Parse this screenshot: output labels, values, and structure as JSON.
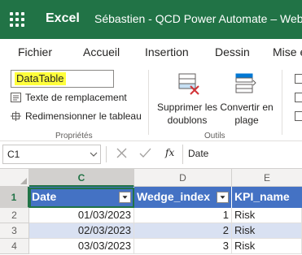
{
  "titlebar": {
    "app_name": "Excel",
    "document_title": "Sébastien - QCD Power Automate – Webi"
  },
  "ribbon_tabs": [
    "Fichier",
    "Accueil",
    "Insertion",
    "Dessin",
    "Mise e"
  ],
  "ribbon": {
    "table_name": "DataTable",
    "replacement_text": "Texte de remplacement",
    "resize_table": "Redimensionner le tableau",
    "properties_group": "Propriétés",
    "remove_duplicates_line1": "Supprimer les",
    "remove_duplicates_line2": "doublons",
    "convert_to_range_line1": "Convertir en",
    "convert_to_range_line2": "plage",
    "tools_group": "Outils"
  },
  "formula_bar": {
    "name_box": "C1",
    "fx_label": "fx",
    "formula": "Date"
  },
  "grid": {
    "columns": [
      "C",
      "D",
      "E"
    ],
    "rows": [
      "1",
      "2",
      "3",
      "4"
    ],
    "headers": [
      "Date",
      "Wedge_index",
      "KPI_name"
    ],
    "data": [
      [
        "01/03/2023",
        "1",
        "Risk"
      ],
      [
        "02/03/2023",
        "2",
        "Risk"
      ],
      [
        "03/03/2023",
        "3",
        "Risk"
      ]
    ]
  },
  "colors": {
    "excel_green": "#217346",
    "table_header_blue": "#4472c4",
    "table_band_blue": "#d9e1f2",
    "highlight_yellow": "#ffff3c"
  }
}
